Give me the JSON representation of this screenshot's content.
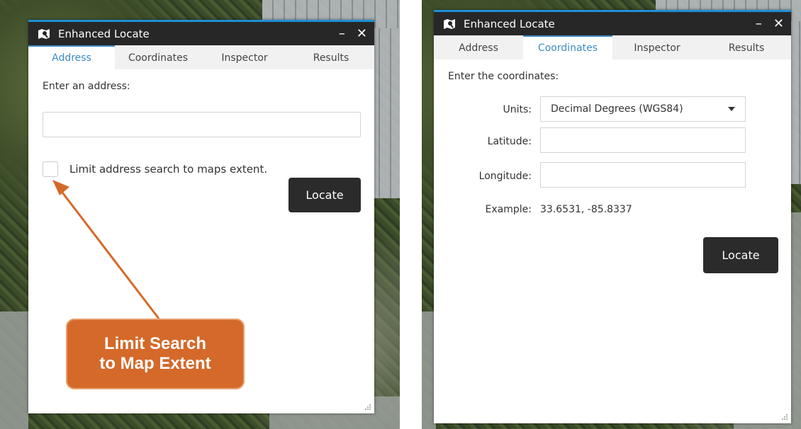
{
  "left_panel": {
    "title": "Enhanced Locate",
    "minimize": "–",
    "close": "✕",
    "tabs": [
      "Address",
      "Coordinates",
      "Inspector",
      "Results"
    ],
    "active_tab": "Address",
    "prompt": "Enter an address:",
    "address_value": "",
    "limit_checkbox_label": "Limit address search to maps extent.",
    "limit_checked": false,
    "locate_label": "Locate"
  },
  "callout": {
    "line1": "Limit Search",
    "line2": "to Map Extent",
    "color": "#d4692a"
  },
  "right_panel": {
    "title": "Enhanced Locate",
    "minimize": "–",
    "close": "✕",
    "tabs": [
      "Address",
      "Coordinates",
      "Inspector",
      "Results"
    ],
    "active_tab": "Coordinates",
    "prompt": "Enter the coordinates:",
    "units_label": "Units:",
    "units_value": "Decimal Degrees (WGS84)",
    "latitude_label": "Latitude:",
    "latitude_value": "",
    "longitude_label": "Longitude:",
    "longitude_value": "",
    "example_label": "Example:",
    "example_value": "33.6531, -85.8337",
    "locate_label": "Locate"
  },
  "colors": {
    "accent": "#3d8cc7",
    "titlebar": "#272727",
    "top_line": "#1f8fd6",
    "button": "#2b2b2b"
  }
}
